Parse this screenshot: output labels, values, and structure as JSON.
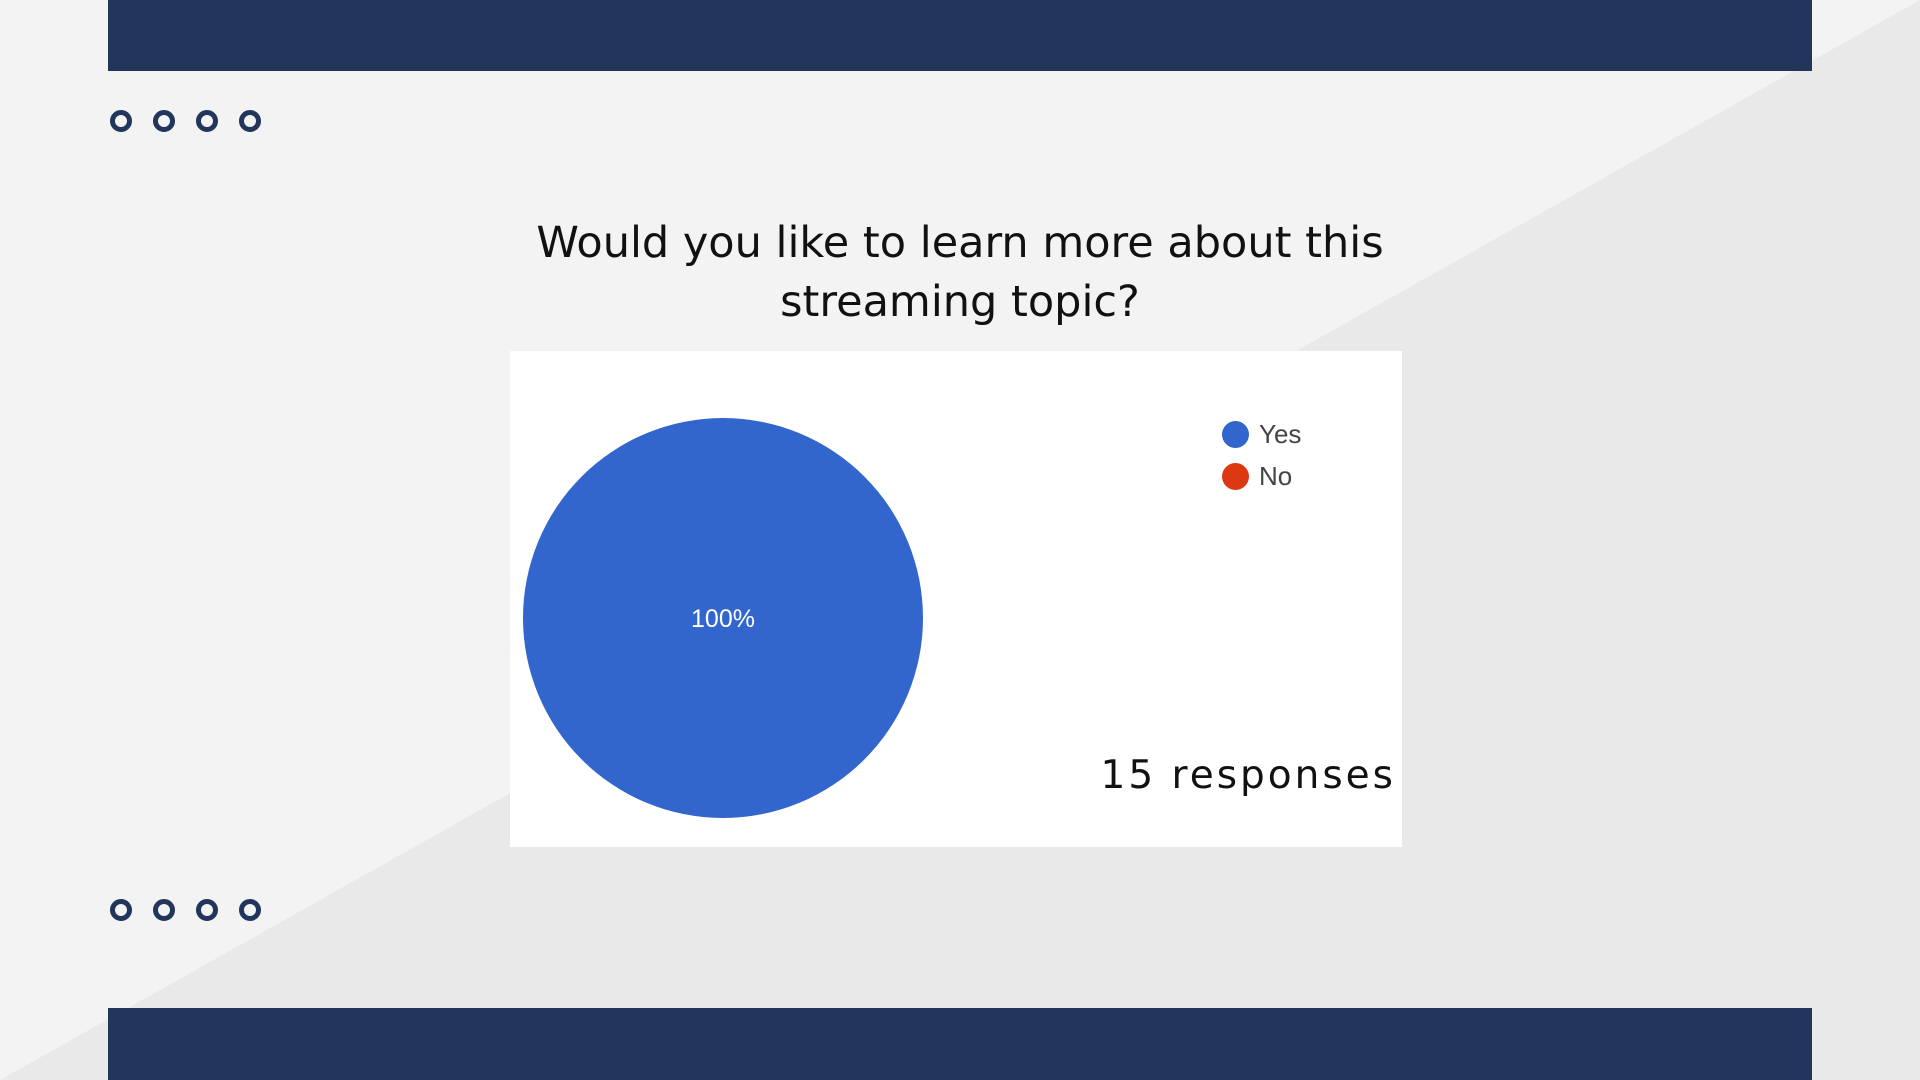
{
  "colors": {
    "navy": "#22355a",
    "background_light": "#f3f3f3",
    "background_shade": "#e9e9e9",
    "card": "#ffffff",
    "yes": "#3366cc",
    "no": "#dc3912"
  },
  "decor": {
    "dot_rows": [
      {
        "count": 4
      },
      {
        "count": 4
      }
    ]
  },
  "question": {
    "line1": "Would you like to learn more about this",
    "line2": "streaming topic?"
  },
  "responses_label": "15 responses",
  "chart_data": {
    "type": "pie",
    "categories": [
      "Yes",
      "No"
    ],
    "values": [
      100,
      0
    ],
    "slice_labels": [
      "100%",
      ""
    ],
    "colors": [
      "#3366cc",
      "#dc3912"
    ],
    "legend": {
      "entries": [
        "Yes",
        "No"
      ],
      "placement": "top-right"
    }
  }
}
